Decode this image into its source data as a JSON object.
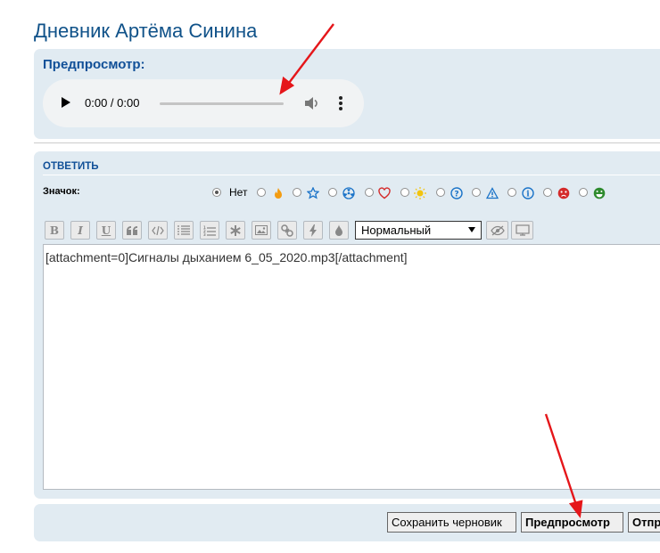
{
  "page": {
    "title": "Дневник Артёма Синина"
  },
  "preview": {
    "heading": "Предпросмотр:",
    "audio": {
      "time": "0:00 / 0:00"
    }
  },
  "reply": {
    "heading": "ОТВЕТИТЬ",
    "icon_label": "Значок:",
    "icon_none_label": "Нет",
    "icons": [
      {
        "name": "fire-icon",
        "color": "#f39c12"
      },
      {
        "name": "star-icon",
        "color": "#1a73c8"
      },
      {
        "name": "radioactive-icon",
        "color": "#1a73c8"
      },
      {
        "name": "heart-icon",
        "color": "#d42a2a"
      },
      {
        "name": "lightbulb-icon",
        "color": "#f2c40f"
      },
      {
        "name": "question-icon",
        "color": "#1a73c8"
      },
      {
        "name": "warning-icon",
        "color": "#1a73c8"
      },
      {
        "name": "info-icon",
        "color": "#1a73c8"
      },
      {
        "name": "sad-face-icon",
        "color": "#d42a2a"
      },
      {
        "name": "grin-face-icon",
        "color": "#2e8b2e"
      }
    ],
    "toolbar": {
      "bold": "B",
      "italic": "I",
      "underline": "U",
      "font_size_selected": "Нормальный"
    },
    "message_text": "[attachment=0]Сигналы дыханием 6_05_2020.mp3[/attachment]"
  },
  "buttons": {
    "save_draft": "Сохранить черновик",
    "preview": "Предпросмотр",
    "submit_partial": "Отпр"
  },
  "colors": {
    "accent": "#105289",
    "panel": "#e1ebf2",
    "annotation_arrow": "#e5161a"
  }
}
